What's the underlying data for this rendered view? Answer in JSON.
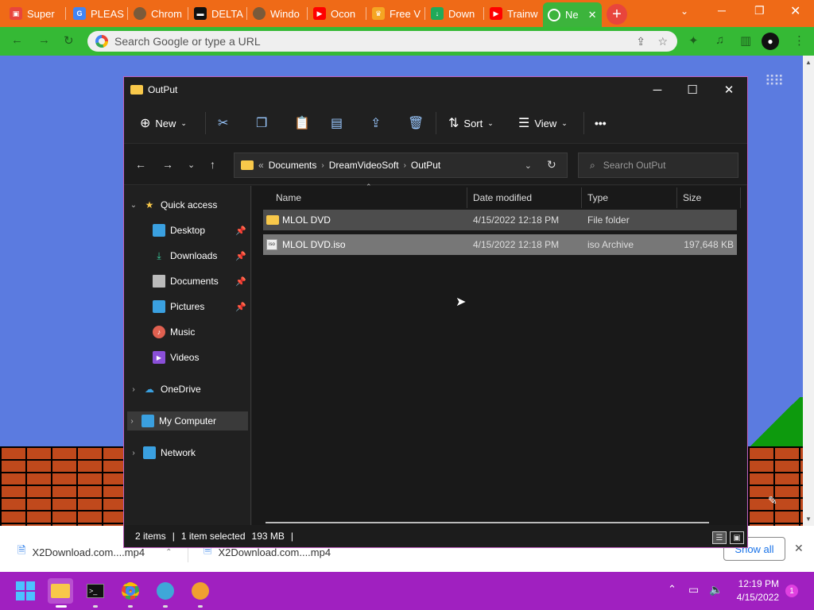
{
  "browser": {
    "tabs": [
      {
        "label": "Super",
        "color": "#e8453c"
      },
      {
        "label": "PLEAS",
        "color": "#4285f4"
      },
      {
        "label": "Chrom",
        "color": "#7a5a3a"
      },
      {
        "label": "DELTA",
        "color": "#111111"
      },
      {
        "label": "Windo",
        "color": "#7a5a3a"
      },
      {
        "label": "Ocon",
        "color": "#ff0000"
      },
      {
        "label": "Free V",
        "color": "#f5a623"
      },
      {
        "label": "Down",
        "color": "#1faa59"
      },
      {
        "label": "Trainw",
        "color": "#ff0000"
      },
      {
        "label": "Ne",
        "color": "#4285f4"
      }
    ],
    "omnibox_placeholder": "Search Google or type a URL"
  },
  "explorer": {
    "title": "OutPut",
    "command_bar": {
      "new": "New",
      "sort": "Sort",
      "view": "View",
      "more": "•••"
    },
    "address": {
      "overflow": "«",
      "crumbs": [
        "Documents",
        "DreamVideoSoft",
        "OutPut"
      ]
    },
    "search_placeholder": "Search OutPut",
    "nav": {
      "quick_access": "Quick access",
      "items": [
        {
          "label": "Desktop",
          "icon": "desktop-icon",
          "pinned": true
        },
        {
          "label": "Downloads",
          "icon": "download-icon",
          "pinned": true
        },
        {
          "label": "Documents",
          "icon": "document-icon",
          "pinned": true
        },
        {
          "label": "Pictures",
          "icon": "picture-icon",
          "pinned": true
        },
        {
          "label": "Music",
          "icon": "music-icon",
          "pinned": false
        },
        {
          "label": "Videos",
          "icon": "video-icon",
          "pinned": false
        }
      ],
      "onedrive": "OneDrive",
      "my_computer": "My Computer",
      "network": "Network"
    },
    "columns": {
      "name": "Name",
      "date": "Date modified",
      "type": "Type",
      "size": "Size"
    },
    "files": [
      {
        "name": "MLOL DVD",
        "date": "4/15/2022 12:18 PM",
        "type": "File folder",
        "size": "",
        "icon": "folder-icon"
      },
      {
        "name": "MLOL DVD.iso",
        "date": "4/15/2022 12:18 PM",
        "type": "iso Archive",
        "size": "197,648 KB",
        "icon": "iso-file-icon"
      }
    ],
    "status": {
      "count": "2 items",
      "selection": "1 item selected",
      "selected_size": "193 MB"
    }
  },
  "downloads_bar": {
    "items": [
      "X2Download.com....mp4",
      "X2Download.com....mp4"
    ],
    "show_all": "Show all"
  },
  "taskbar": {
    "time": "12:19 PM",
    "date": "4/15/2022",
    "notification_count": "1"
  }
}
